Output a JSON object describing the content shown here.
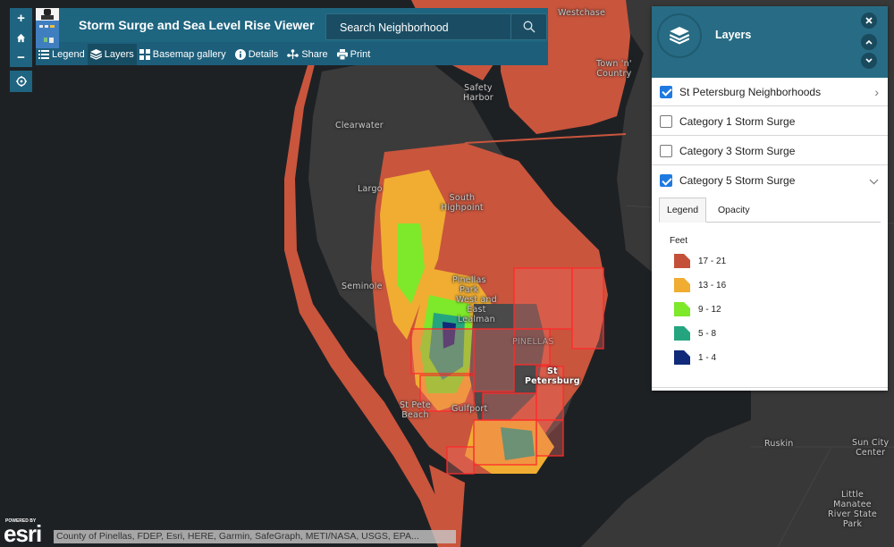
{
  "app": {
    "title": "Storm Surge and Sea Level Rise Viewer",
    "search_placeholder": "Search Neighborhood",
    "logo_icon": "app-logo-icon"
  },
  "zoom_controls": {
    "zoom_in": "+",
    "zoom_out": "−",
    "home_icon": "home-icon",
    "locate_icon": "locate-icon"
  },
  "toolbar": {
    "items": [
      {
        "label": "Legend",
        "icon": "list-icon",
        "active": false
      },
      {
        "label": "Layers",
        "icon": "layers-icon",
        "active": true
      },
      {
        "label": "Basemap gallery",
        "icon": "grid-icon",
        "active": false
      },
      {
        "label": "Details",
        "icon": "info-icon",
        "active": false
      },
      {
        "label": "Share",
        "icon": "share-icon",
        "active": false
      },
      {
        "label": "Print",
        "icon": "print-icon",
        "active": false
      }
    ]
  },
  "layers_panel": {
    "title": "Layers",
    "controls": [
      "close",
      "collapse-up",
      "collapse-down"
    ],
    "layers": [
      {
        "label": "St Petersburg Neighborhoods",
        "checked": true,
        "chevron": "›"
      },
      {
        "label": "Category 1 Storm Surge",
        "checked": false,
        "chevron": ""
      },
      {
        "label": "Category 3 Storm Surge",
        "checked": false,
        "chevron": ""
      },
      {
        "label": "Category 5 Storm Surge",
        "checked": true,
        "chevron": "⌄"
      }
    ],
    "tabs": [
      {
        "label": "Legend",
        "active": true
      },
      {
        "label": "Opacity",
        "active": false
      }
    ],
    "legend": {
      "unit": "Feet",
      "items": [
        {
          "label": "17 - 21",
          "color": "#c4503a"
        },
        {
          "label": "13 - 16",
          "color": "#f0ad32"
        },
        {
          "label": "9 - 12",
          "color": "#7ee82a"
        },
        {
          "label": "5 - 8",
          "color": "#25a57f"
        },
        {
          "label": "1 - 4",
          "color": "#112a7a"
        }
      ]
    }
  },
  "map": {
    "labels": [
      {
        "text": "Westchase"
      },
      {
        "text": "Town 'n'\nCountry"
      },
      {
        "text": "Safety\nHarbor"
      },
      {
        "text": "Clearwater"
      },
      {
        "text": "Largo"
      },
      {
        "text": "South\nHighpoint"
      },
      {
        "text": "Seminole"
      },
      {
        "text": "Pinellas\nPark"
      },
      {
        "text": "West and\nEast\nLealman"
      },
      {
        "text": "PINELLAS"
      },
      {
        "text": "St\nPetersburg"
      },
      {
        "text": "St Pete\nBeach"
      },
      {
        "text": "Gulfport"
      },
      {
        "text": "Ruskin"
      },
      {
        "text": "Sun City\nCenter"
      },
      {
        "text": "Little\nManatee\nRiver State\nPark"
      }
    ],
    "colors": {
      "water": "#1e2124",
      "land": "#3a3a3a",
      "surge_high": "#c9553d",
      "neighborhood_outline": "#ff2a2a"
    }
  },
  "attribution": {
    "powered_by": "POWERED BY",
    "brand": "esri",
    "text": "County of Pinellas, FDEP, Esri, HERE, Garmin, SafeGraph, METI/NASA, USGS, EPA..."
  }
}
